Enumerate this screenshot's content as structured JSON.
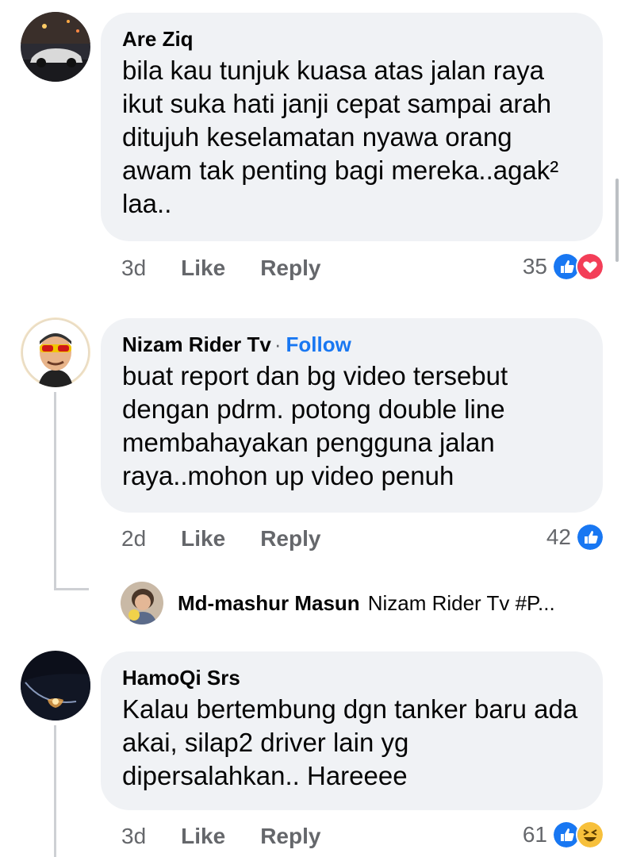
{
  "comments": [
    {
      "author": "Are Ziq",
      "text": "bila kau tunjuk kuasa atas jalan raya ikut suka hati janji cepat sampai arah ditujuh keselamatan nyawa orang awam tak penting bagi mereka..agak² laa..",
      "time": "3d",
      "like_label": "Like",
      "reply_label": "Reply",
      "reaction_count": "35",
      "reactions": [
        "like-icon",
        "love-icon"
      ]
    },
    {
      "author": "Nizam Rider Tv",
      "follow_label": "Follow",
      "text": "buat report dan bg video tersebut dengan pdrm. potong double line membahayakan pengguna jalan raya..mohon up video penuh",
      "time": "2d",
      "like_label": "Like",
      "reply_label": "Reply",
      "reaction_count": "42",
      "reactions": [
        "like-icon"
      ],
      "reply_preview": {
        "author": "Md-mashur Masun",
        "text": "Nizam Rider Tv #P..."
      }
    },
    {
      "author": "HamoQi Srs",
      "text": "Kalau bertembung dgn tanker baru ada akai, silap2 driver lain yg dipersalahkan.. Hareeee",
      "time": "3d",
      "like_label": "Like",
      "reply_label": "Reply",
      "reaction_count": "61",
      "reactions": [
        "like-icon",
        "haha-icon"
      ]
    }
  ],
  "colors": {
    "bubble": "#f0f2f5",
    "meta": "#65676b",
    "link": "#1877f2"
  }
}
